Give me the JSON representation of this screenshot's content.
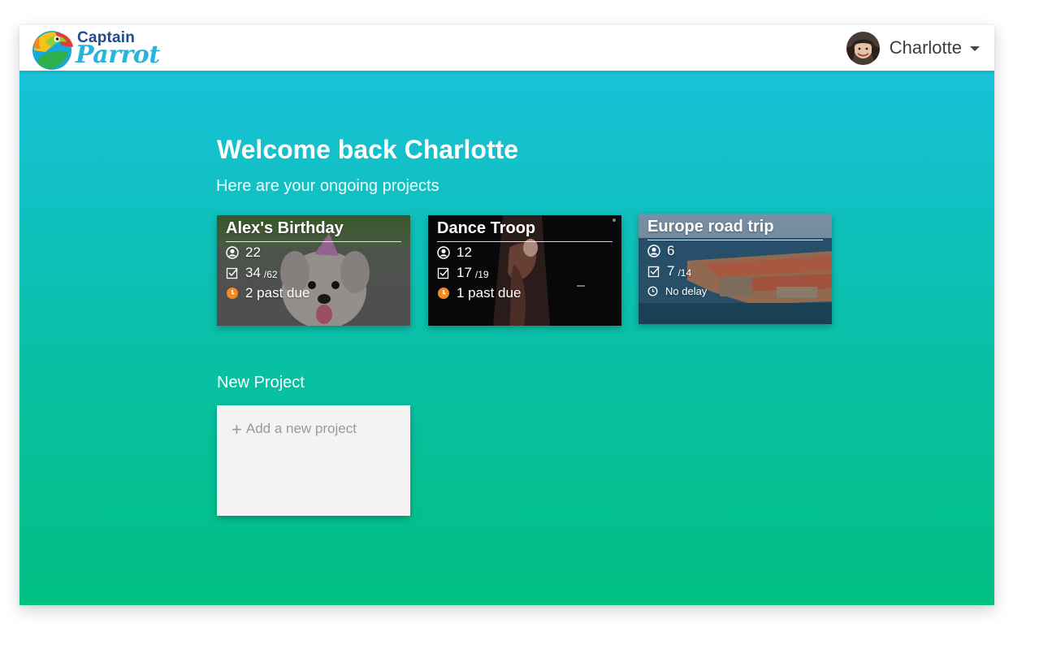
{
  "app": {
    "logo": {
      "line1": "Captain",
      "line2": "Parrot"
    },
    "user": {
      "name": "Charlotte"
    }
  },
  "main": {
    "welcome": "Welcome back Charlotte",
    "subtitle": "Here are your ongoing projects",
    "projects": [
      {
        "title": "Alex's Birthday",
        "members": "22",
        "tasks_done": "34",
        "tasks_total": "/62",
        "status": "2 past due",
        "status_type": "past-due"
      },
      {
        "title": "Dance Troop",
        "members": "12",
        "tasks_done": "17",
        "tasks_total": "/19",
        "status": "1 past due",
        "status_type": "past-due"
      },
      {
        "title": "Europe road trip",
        "members": "6",
        "tasks_done": "7",
        "tasks_total": "/14",
        "status": "No delay",
        "status_type": "ok"
      }
    ],
    "new_project": {
      "label": "New Project",
      "add_text": "Add a new project"
    }
  },
  "colors": {
    "gradient_top": "#18c1d9",
    "gradient_bottom": "#00bf82",
    "past_due_icon": "#f08a24",
    "logo_navy": "#1f4c8c",
    "logo_cyan": "#25b6d9"
  },
  "icons": {
    "members": "user-circle-icon",
    "tasks": "checkbox-icon",
    "past_due": "alert-clock-icon",
    "no_delay": "clock-icon",
    "add": "plus-icon",
    "menu": "caret-down-icon"
  }
}
